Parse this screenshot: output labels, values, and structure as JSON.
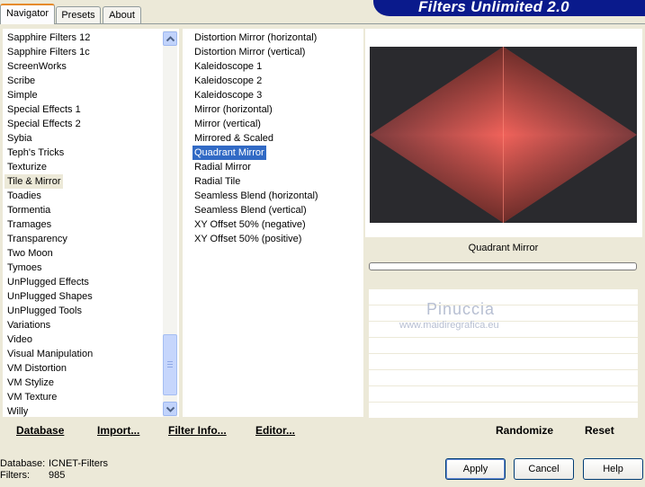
{
  "tabs": [
    "Navigator",
    "Presets",
    "About"
  ],
  "banner_title": "Filters Unlimited 2.0",
  "categories": [
    "Sapphire Filters 12",
    "Sapphire Filters 1c",
    "ScreenWorks",
    "Scribe",
    "Simple",
    "Special Effects 1",
    "Special Effects 2",
    "Sybia",
    "Teph's Tricks",
    "Texturize",
    "Tile & Mirror",
    "Toadies",
    "Tormentia",
    "Tramages",
    "Transparency",
    "Two Moon",
    "Tymoes",
    "UnPlugged Effects",
    "UnPlugged Shapes",
    "UnPlugged Tools",
    "Variations",
    "Video",
    "Visual Manipulation",
    "VM Distortion",
    "VM Stylize",
    "VM Texture",
    "Willy"
  ],
  "selected_category": "Tile & Mirror",
  "filters": [
    "Distortion Mirror (horizontal)",
    "Distortion Mirror (vertical)",
    "Kaleidoscope 1",
    "Kaleidoscope 2",
    "Kaleidoscope 3",
    "Mirror (horizontal)",
    "Mirror (vertical)",
    "Mirrored & Scaled",
    "Quadrant Mirror",
    "Radial Mirror",
    "Radial Tile",
    "Seamless Blend (horizontal)",
    "Seamless Blend (vertical)",
    "XY Offset 50% (negative)",
    "XY Offset 50% (positive)"
  ],
  "selected_filter": "Quadrant Mirror",
  "preview": {
    "label": "Quadrant Mirror",
    "outer_color": "#2a2a2e",
    "center_color": "#f0625a",
    "mid_color": "#7a3a3c"
  },
  "watermark": {
    "name": "Pinuccia",
    "url": "www.maidiregrafica.eu"
  },
  "toolbar": {
    "database": "Database",
    "import": "Import...",
    "filter_info": "Filter Info...",
    "editor": "Editor...",
    "randomize": "Randomize",
    "reset": "Reset"
  },
  "info": {
    "database_label": "Database:",
    "database_value": "ICNET-Filters",
    "filters_label": "Filters:",
    "filters_value": "985"
  },
  "buttons": {
    "apply": "Apply",
    "cancel": "Cancel",
    "help": "Help"
  },
  "colors": {
    "selection": "#316ac5",
    "banner": "#0a1a8c",
    "tab_highlight": "#e68b2c"
  }
}
